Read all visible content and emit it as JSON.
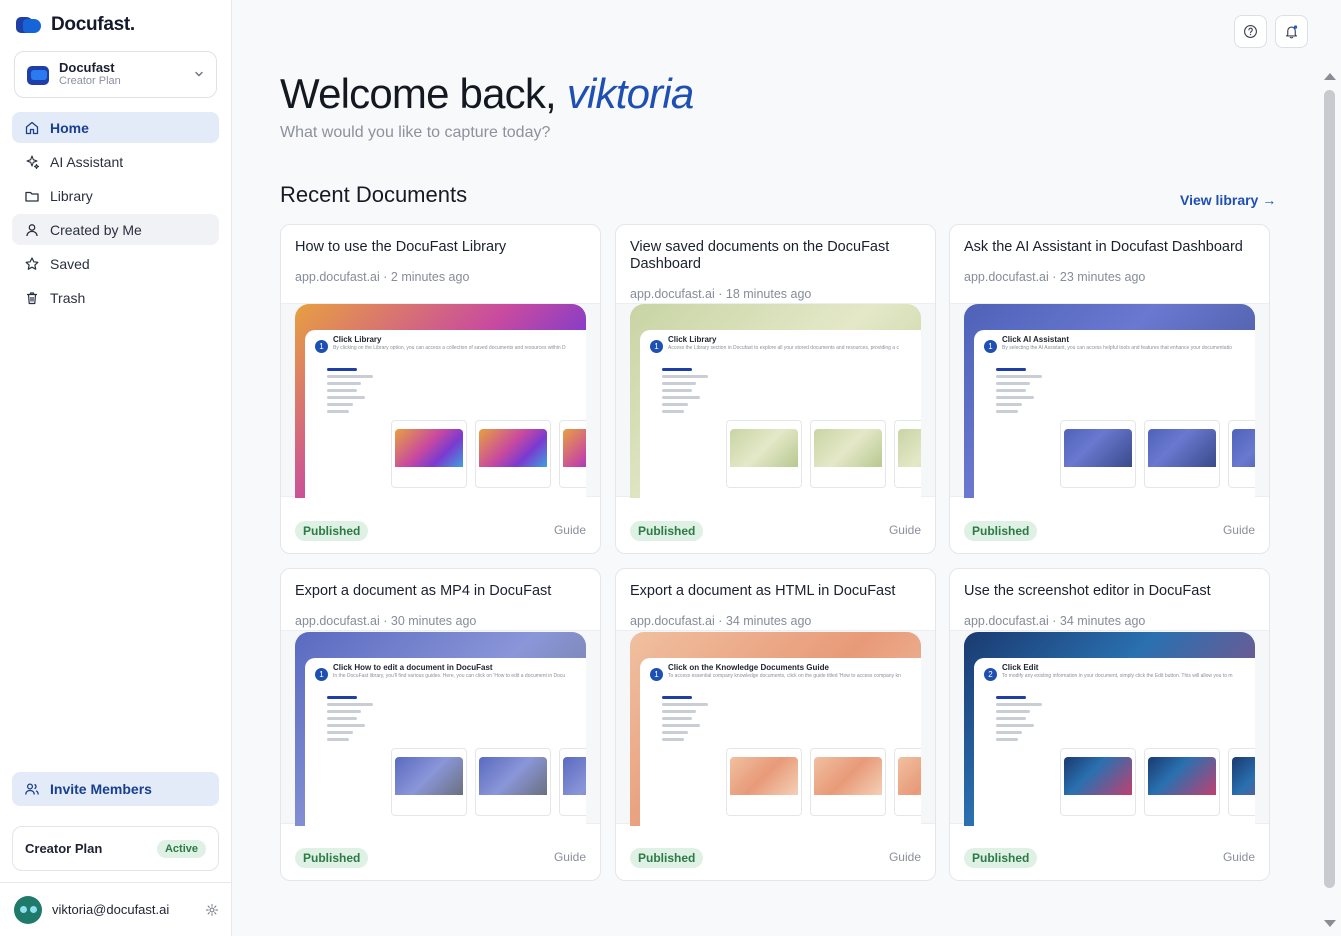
{
  "brand": {
    "name": "Docufast."
  },
  "workspace": {
    "name": "Docufast",
    "plan": "Creator Plan"
  },
  "nav": [
    {
      "label": "Home",
      "icon": "home-icon",
      "state": "active"
    },
    {
      "label": "AI Assistant",
      "icon": "sparkle-icon",
      "state": ""
    },
    {
      "label": "Library",
      "icon": "folder-icon",
      "state": ""
    },
    {
      "label": "Created by Me",
      "icon": "user-icon",
      "state": "hover"
    },
    {
      "label": "Saved",
      "icon": "star-icon",
      "state": ""
    },
    {
      "label": "Trash",
      "icon": "trash-icon",
      "state": ""
    }
  ],
  "invite": {
    "label": "Invite Members"
  },
  "plan": {
    "label": "Creator Plan",
    "status": "Active"
  },
  "user": {
    "email": "viktoria@docufast.ai"
  },
  "header": {
    "greeting": "Welcome back,",
    "name": "viktoria",
    "subtitle": "What would you like to capture today?"
  },
  "recent": {
    "title": "Recent Documents",
    "view_library": "View library →"
  },
  "documents": [
    {
      "title": "How to use the DocuFast Library",
      "meta": "app.docufast.ai · 2 minutes ago",
      "status": "Published",
      "kind": "Guide",
      "thumb": {
        "step": "1",
        "title": "Click Library",
        "desc": "By clicking on the Library option, you can access a collection of saved documents and resources within D",
        "gradient": "linear-gradient(135deg,#e8a040 0%,#c84aa0 45%,#7a3ad0 70%,#3fa0e0 100%)"
      }
    },
    {
      "title": "View saved documents on the DocuFast Dashboard",
      "meta": "app.docufast.ai · 18 minutes ago",
      "status": "Published",
      "kind": "Guide",
      "thumb": {
        "step": "1",
        "title": "Click Library",
        "desc": "Access the Library section in Docufast to explore all your stored documents and resources, providing a c",
        "gradient": "linear-gradient(135deg,#c8d4a4 0%,#e4e8c8 50%,#b8c890 100%)"
      }
    },
    {
      "title": "Ask the AI Assistant in Docufast Dashboard",
      "meta": "app.docufast.ai · 23 minutes ago",
      "status": "Published",
      "kind": "Guide",
      "thumb": {
        "step": "1",
        "title": "Click AI Assistant",
        "desc": "By selecting the AI Assistant, you can access helpful tools and features that enhance your documentatio",
        "gradient": "linear-gradient(135deg,#4e62b8 0%,#6a78d0 40%,#3a4a8a 100%)"
      }
    },
    {
      "title": "Export a document as MP4 in DocuFast",
      "meta": "app.docufast.ai · 30 minutes ago",
      "status": "Published",
      "kind": "Guide",
      "thumb": {
        "step": "1",
        "title": "Click How to edit a document in DocuFast",
        "desc": "In the DocuFast library, you'll find various guides. Here, you can click on 'How to edit a document in Docu",
        "gradient": "linear-gradient(135deg,#5a6ac0 0%,#8a96d8 50%,#6a7080 100%)"
      }
    },
    {
      "title": "Export a document as HTML in DocuFast",
      "meta": "app.docufast.ai · 34 minutes ago",
      "status": "Published",
      "kind": "Guide",
      "thumb": {
        "step": "1",
        "title": "Click on the Knowledge Documents Guide",
        "desc": "To access essential company knowledge documents, click on the guide titled 'How to access company kn",
        "gradient": "linear-gradient(135deg,#f0c0a0 0%,#e89a78 50%,#f4d0b8 100%)"
      }
    },
    {
      "title": "Use the screenshot editor in DocuFast",
      "meta": "app.docufast.ai · 34 minutes ago",
      "status": "Published",
      "kind": "Guide",
      "thumb": {
        "step": "2",
        "title": "Click Edit",
        "desc": "To modify any existing information in your document, simply click the Edit button. This will allow you to m",
        "gradient": "linear-gradient(135deg,#1a3a70 0%,#2a70b0 40%,#c04070 100%)"
      }
    }
  ]
}
